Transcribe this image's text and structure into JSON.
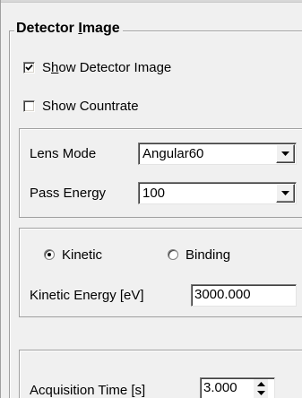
{
  "group": {
    "title_prefix": "Detector ",
    "title_accel": "I",
    "title_suffix": "mage"
  },
  "show_detector": {
    "label_prefix": "S",
    "label_accel": "h",
    "label_suffix": "ow Detector Image",
    "checked": true
  },
  "show_countrate": {
    "label": "Show Countrate",
    "checked": false
  },
  "lens": {
    "lens_mode_label": "Lens Mode",
    "lens_mode_value": "Angular60",
    "pass_energy_label": "Pass Energy",
    "pass_energy_value": "100"
  },
  "energy": {
    "kinetic_label": "Kinetic",
    "binding_label": "Binding",
    "selected": "Kinetic",
    "kinetic_energy_label": "Kinetic Energy [eV]",
    "kinetic_energy_value": "3000.000"
  },
  "acquisition": {
    "label": "Acquisition Time [s]",
    "value": "3.000"
  },
  "icons": {
    "checkmark": "checkmark-icon",
    "dropdown": "chevron-down-icon",
    "spin_up": "spin-up-icon",
    "spin_down": "spin-down-icon"
  }
}
